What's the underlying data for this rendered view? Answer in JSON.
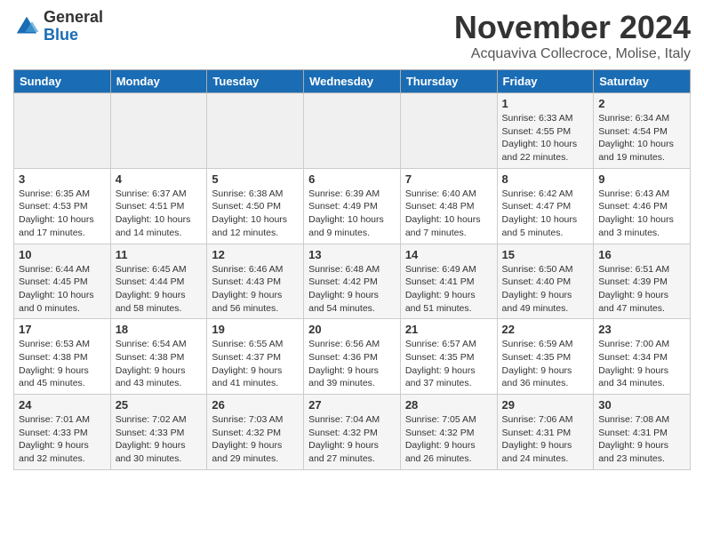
{
  "header": {
    "logo_general": "General",
    "logo_blue": "Blue",
    "month_title": "November 2024",
    "location": "Acquaviva Collecroce, Molise, Italy"
  },
  "days_of_week": [
    "Sunday",
    "Monday",
    "Tuesday",
    "Wednesday",
    "Thursday",
    "Friday",
    "Saturday"
  ],
  "weeks": [
    [
      {
        "day": "",
        "info": ""
      },
      {
        "day": "",
        "info": ""
      },
      {
        "day": "",
        "info": ""
      },
      {
        "day": "",
        "info": ""
      },
      {
        "day": "",
        "info": ""
      },
      {
        "day": "1",
        "info": "Sunrise: 6:33 AM\nSunset: 4:55 PM\nDaylight: 10 hours and 22 minutes."
      },
      {
        "day": "2",
        "info": "Sunrise: 6:34 AM\nSunset: 4:54 PM\nDaylight: 10 hours and 19 minutes."
      }
    ],
    [
      {
        "day": "3",
        "info": "Sunrise: 6:35 AM\nSunset: 4:53 PM\nDaylight: 10 hours and 17 minutes."
      },
      {
        "day": "4",
        "info": "Sunrise: 6:37 AM\nSunset: 4:51 PM\nDaylight: 10 hours and 14 minutes."
      },
      {
        "day": "5",
        "info": "Sunrise: 6:38 AM\nSunset: 4:50 PM\nDaylight: 10 hours and 12 minutes."
      },
      {
        "day": "6",
        "info": "Sunrise: 6:39 AM\nSunset: 4:49 PM\nDaylight: 10 hours and 9 minutes."
      },
      {
        "day": "7",
        "info": "Sunrise: 6:40 AM\nSunset: 4:48 PM\nDaylight: 10 hours and 7 minutes."
      },
      {
        "day": "8",
        "info": "Sunrise: 6:42 AM\nSunset: 4:47 PM\nDaylight: 10 hours and 5 minutes."
      },
      {
        "day": "9",
        "info": "Sunrise: 6:43 AM\nSunset: 4:46 PM\nDaylight: 10 hours and 3 minutes."
      }
    ],
    [
      {
        "day": "10",
        "info": "Sunrise: 6:44 AM\nSunset: 4:45 PM\nDaylight: 10 hours and 0 minutes."
      },
      {
        "day": "11",
        "info": "Sunrise: 6:45 AM\nSunset: 4:44 PM\nDaylight: 9 hours and 58 minutes."
      },
      {
        "day": "12",
        "info": "Sunrise: 6:46 AM\nSunset: 4:43 PM\nDaylight: 9 hours and 56 minutes."
      },
      {
        "day": "13",
        "info": "Sunrise: 6:48 AM\nSunset: 4:42 PM\nDaylight: 9 hours and 54 minutes."
      },
      {
        "day": "14",
        "info": "Sunrise: 6:49 AM\nSunset: 4:41 PM\nDaylight: 9 hours and 51 minutes."
      },
      {
        "day": "15",
        "info": "Sunrise: 6:50 AM\nSunset: 4:40 PM\nDaylight: 9 hours and 49 minutes."
      },
      {
        "day": "16",
        "info": "Sunrise: 6:51 AM\nSunset: 4:39 PM\nDaylight: 9 hours and 47 minutes."
      }
    ],
    [
      {
        "day": "17",
        "info": "Sunrise: 6:53 AM\nSunset: 4:38 PM\nDaylight: 9 hours and 45 minutes."
      },
      {
        "day": "18",
        "info": "Sunrise: 6:54 AM\nSunset: 4:38 PM\nDaylight: 9 hours and 43 minutes."
      },
      {
        "day": "19",
        "info": "Sunrise: 6:55 AM\nSunset: 4:37 PM\nDaylight: 9 hours and 41 minutes."
      },
      {
        "day": "20",
        "info": "Sunrise: 6:56 AM\nSunset: 4:36 PM\nDaylight: 9 hours and 39 minutes."
      },
      {
        "day": "21",
        "info": "Sunrise: 6:57 AM\nSunset: 4:35 PM\nDaylight: 9 hours and 37 minutes."
      },
      {
        "day": "22",
        "info": "Sunrise: 6:59 AM\nSunset: 4:35 PM\nDaylight: 9 hours and 36 minutes."
      },
      {
        "day": "23",
        "info": "Sunrise: 7:00 AM\nSunset: 4:34 PM\nDaylight: 9 hours and 34 minutes."
      }
    ],
    [
      {
        "day": "24",
        "info": "Sunrise: 7:01 AM\nSunset: 4:33 PM\nDaylight: 9 hours and 32 minutes."
      },
      {
        "day": "25",
        "info": "Sunrise: 7:02 AM\nSunset: 4:33 PM\nDaylight: 9 hours and 30 minutes."
      },
      {
        "day": "26",
        "info": "Sunrise: 7:03 AM\nSunset: 4:32 PM\nDaylight: 9 hours and 29 minutes."
      },
      {
        "day": "27",
        "info": "Sunrise: 7:04 AM\nSunset: 4:32 PM\nDaylight: 9 hours and 27 minutes."
      },
      {
        "day": "28",
        "info": "Sunrise: 7:05 AM\nSunset: 4:32 PM\nDaylight: 9 hours and 26 minutes."
      },
      {
        "day": "29",
        "info": "Sunrise: 7:06 AM\nSunset: 4:31 PM\nDaylight: 9 hours and 24 minutes."
      },
      {
        "day": "30",
        "info": "Sunrise: 7:08 AM\nSunset: 4:31 PM\nDaylight: 9 hours and 23 minutes."
      }
    ]
  ]
}
